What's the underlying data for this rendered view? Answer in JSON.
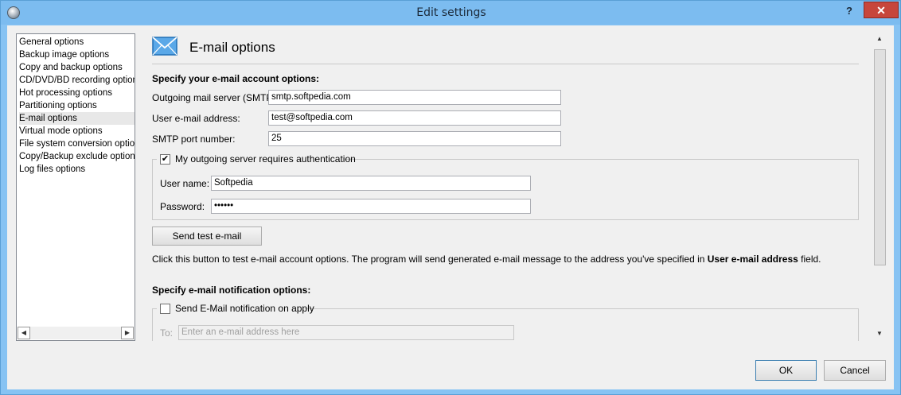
{
  "window": {
    "title": "Edit settings",
    "help_label": "?",
    "close_label": "✕"
  },
  "nav": {
    "items": [
      {
        "label": "General options",
        "selected": false
      },
      {
        "label": "Backup image options",
        "selected": false
      },
      {
        "label": "Copy and backup options",
        "selected": false
      },
      {
        "label": "CD/DVD/BD recording options",
        "selected": false
      },
      {
        "label": "Hot processing options",
        "selected": false
      },
      {
        "label": "Partitioning options",
        "selected": false
      },
      {
        "label": "E-mail options",
        "selected": true
      },
      {
        "label": "Virtual mode options",
        "selected": false
      },
      {
        "label": "File system conversion options",
        "selected": false
      },
      {
        "label": "Copy/Backup exclude options",
        "selected": false
      },
      {
        "label": "Log files options",
        "selected": false
      }
    ]
  },
  "page": {
    "title": "E-mail options",
    "account_header": "Specify your e-mail account options:",
    "smtp_label": "Outgoing mail server (SMTP):",
    "smtp_value": "smtp.softpedia.com",
    "email_label": "User e-mail address:",
    "email_value": "test@softpedia.com",
    "port_label": "SMTP port number:",
    "port_value": "25",
    "auth_label": "My outgoing server requires authentication",
    "auth_checked": true,
    "username_label": "User name:",
    "username_value": "Softpedia",
    "password_label": "Password:",
    "password_value": "••••••",
    "send_test_label": "Send test e-mail",
    "desc_prefix": "Click this button to test e-mail account options. The program will send generated e-mail message to the address you've specified in ",
    "desc_bold": "User e-mail address",
    "desc_suffix": " field.",
    "notify_header": "Specify e-mail notification options:",
    "notify_label": "Send E-Mail notification on apply",
    "notify_checked": false,
    "to_label": "To:",
    "to_placeholder": "Enter an e-mail address here"
  },
  "footer": {
    "ok_label": "OK",
    "cancel_label": "Cancel"
  },
  "colors": {
    "titlebar": "#7cbcf0",
    "close": "#c7463b",
    "accent": "#3c7fb1"
  }
}
